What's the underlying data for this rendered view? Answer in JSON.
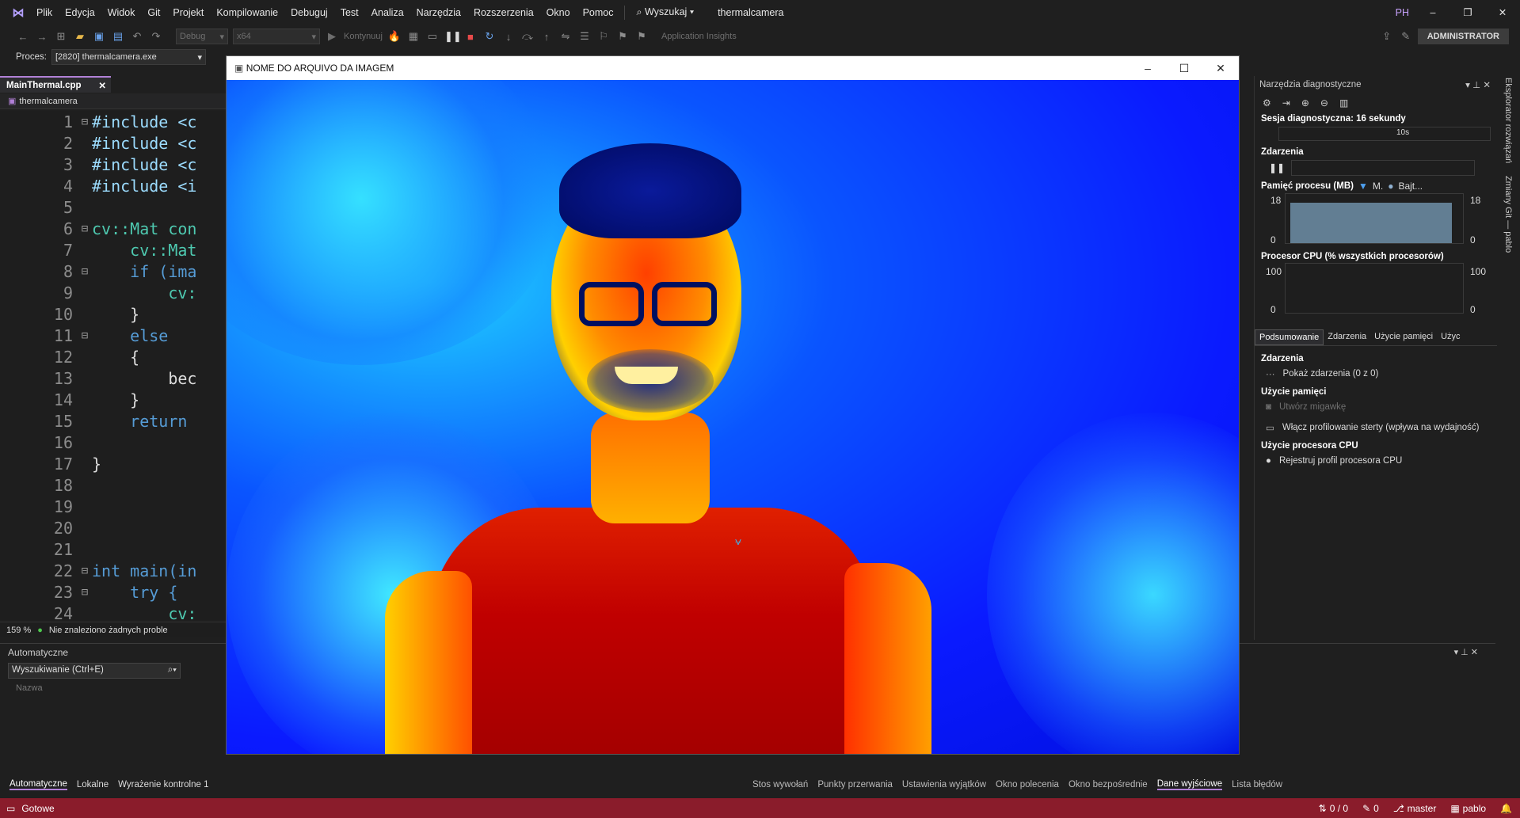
{
  "menu": {
    "items": [
      "Plik",
      "Edycja",
      "Widok",
      "Git",
      "Projekt",
      "Kompilowanie",
      "Debuguj",
      "Test",
      "Analiza",
      "Narzędzia",
      "Rozszerzenia",
      "Okno",
      "Pomoc"
    ],
    "search": "Wyszukaj",
    "solution": "thermalcamera",
    "user_initials": "PH",
    "admin": "ADMINISTRATOR"
  },
  "toolbar": {
    "config": "Debug",
    "platform": "x64",
    "continue": "Kontynuuj",
    "insights": "Application Insights"
  },
  "process": {
    "label": "Proces:",
    "value": "[2820] thermalcamera.exe"
  },
  "editor": {
    "tab": "MainThermal.cpp",
    "nav": "thermalcamera",
    "zoom": "159 %",
    "problems": "Nie znaleziono żadnych proble",
    "lines": [
      {
        "n": "1",
        "fold": "⊟",
        "t": "#include <c"
      },
      {
        "n": "2",
        "fold": "",
        "t": "#include <c"
      },
      {
        "n": "3",
        "fold": "",
        "t": "#include <c"
      },
      {
        "n": "4",
        "fold": "",
        "t": "#include <i"
      },
      {
        "n": "5",
        "fold": "",
        "t": ""
      },
      {
        "n": "6",
        "fold": "⊟",
        "t": "cv::Mat con"
      },
      {
        "n": "7",
        "fold": "",
        "t": "    cv::Mat"
      },
      {
        "n": "8",
        "fold": "⊟",
        "t": "    if (ima"
      },
      {
        "n": "9",
        "fold": "",
        "t": "        cv:"
      },
      {
        "n": "10",
        "fold": "",
        "t": "    }"
      },
      {
        "n": "11",
        "fold": "⊟",
        "t": "    else"
      },
      {
        "n": "12",
        "fold": "",
        "t": "    {"
      },
      {
        "n": "13",
        "fold": "",
        "t": "        bec"
      },
      {
        "n": "14",
        "fold": "",
        "t": "    }"
      },
      {
        "n": "15",
        "fold": "",
        "t": "    return"
      },
      {
        "n": "16",
        "fold": "",
        "t": ""
      },
      {
        "n": "17",
        "fold": "",
        "t": "}"
      },
      {
        "n": "18",
        "fold": "",
        "t": ""
      },
      {
        "n": "19",
        "fold": "",
        "t": ""
      },
      {
        "n": "20",
        "fold": "",
        "t": ""
      },
      {
        "n": "21",
        "fold": "",
        "t": ""
      },
      {
        "n": "22",
        "fold": "⊟",
        "t": "int main(in"
      },
      {
        "n": "23",
        "fold": "⊟",
        "t": "    try {"
      },
      {
        "n": "24",
        "fold": "",
        "t": "        cv:"
      }
    ]
  },
  "autos": {
    "title": "Automatyczne",
    "search": "Wyszukiwanie (Ctrl+E)",
    "col": "Nazwa"
  },
  "bottom_left_tabs": [
    "Automatyczne",
    "Lokalne",
    "Wyrażenie kontrolne 1"
  ],
  "bottom_right_tabs": [
    "Stos wywołań",
    "Punkty przerwania",
    "Ustawienia wyjątków",
    "Okno polecenia",
    "Okno bezpośrednie",
    "Dane wyjściowe",
    "Lista błędów"
  ],
  "status": {
    "ready": "Gotowe",
    "lines": "0 / 0",
    "edits": "0",
    "branch": "master",
    "repo": "pablo"
  },
  "window": {
    "title": "NOME DO ARQUIVO DA IMAGEM"
  },
  "diag": {
    "title": "Narzędzia diagnostyczne",
    "session": "Sesja diagnostyczna: 16 sekundy",
    "time_tick": "10s",
    "events": "Zdarzenia",
    "memory": "Pamięć procesu (MB)",
    "legend_m": "M.",
    "legend_b": "Bajt...",
    "mem_max": "18",
    "mem_min": "0",
    "cpu": "Procesor CPU (% wszystkich procesorów)",
    "cpu_max": "100",
    "cpu_min": "0",
    "memory_level": 0.82,
    "tabs": [
      "Podsumowanie",
      "Zdarzenia",
      "Użycie pamięci",
      "Użyc"
    ],
    "s_events": "Zdarzenia",
    "show_events": "Pokaż zdarzenia (0 z 0)",
    "s_mem": "Użycie pamięci",
    "snapshot": "Utwórz migawkę",
    "heap": "Włącz profilowanie sterty (wpływa na wydajność)",
    "s_cpu": "Użycie procesora CPU",
    "cpu_profile": "Rejestruj profil procesora CPU"
  },
  "side": {
    "explorer": "Eksplorator rozwiązań",
    "git": "Zmiany Git — pablo"
  }
}
